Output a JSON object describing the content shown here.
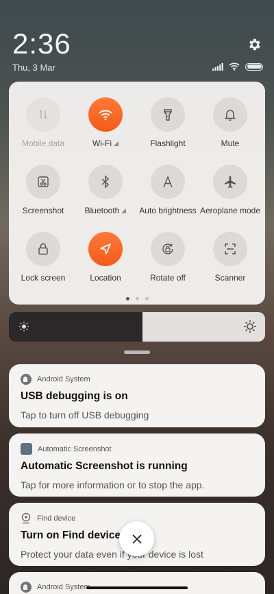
{
  "status": {
    "time": "2:36",
    "date": "Thu, 3 Mar",
    "icons": [
      "signal-icon",
      "wifi-icon",
      "battery-icon"
    ]
  },
  "quick_settings": {
    "tiles": [
      {
        "label": "Mobile data",
        "icon": "mobile-data-icon",
        "state": "disabled"
      },
      {
        "label": "Wi-Fi",
        "icon": "wifi-icon",
        "state": "on"
      },
      {
        "label": "Flashlight",
        "icon": "flashlight-icon",
        "state": "off"
      },
      {
        "label": "Mute",
        "icon": "bell-icon",
        "state": "off"
      },
      {
        "label": "Screenshot",
        "icon": "screenshot-icon",
        "state": "off"
      },
      {
        "label": "Bluetooth",
        "icon": "bluetooth-icon",
        "state": "off"
      },
      {
        "label": "Auto brightness",
        "icon": "auto-brightness-icon",
        "state": "off"
      },
      {
        "label": "Aeroplane mode",
        "icon": "airplane-icon",
        "state": "off"
      },
      {
        "label": "Lock screen",
        "icon": "lock-icon",
        "state": "off"
      },
      {
        "label": "Location",
        "icon": "location-icon",
        "state": "on"
      },
      {
        "label": "Rotate off",
        "icon": "rotate-lock-icon",
        "state": "off"
      },
      {
        "label": "Scanner",
        "icon": "scanner-icon",
        "state": "off"
      }
    ],
    "page_count": 3,
    "current_page": 1
  },
  "brightness": {
    "level": 0.52
  },
  "notifications": [
    {
      "app": "Android System",
      "icon": "android-system-icon",
      "title": "USB debugging is on",
      "body": "Tap to turn off USB debugging"
    },
    {
      "app": "Automatic Screenshot",
      "icon": "automatic-screenshot-icon",
      "title": "Automatic Screenshot is running",
      "body": "Tap for more information or to stop the app."
    },
    {
      "app": "Find device",
      "icon": "find-device-icon",
      "title": "Turn on Find device",
      "body": "Protect your data even if your device is lost"
    },
    {
      "app": "Android System",
      "icon": "android-system-icon",
      "title": "",
      "body": ""
    }
  ],
  "colors": {
    "accent": "#f5621e",
    "panel": "#f4f3f2"
  }
}
